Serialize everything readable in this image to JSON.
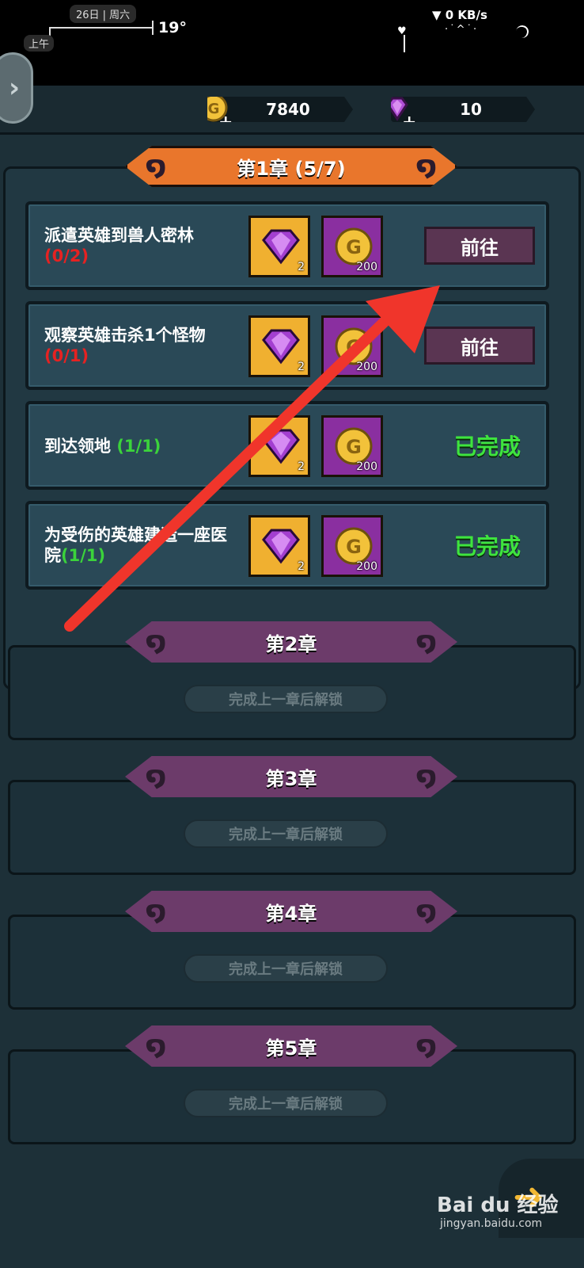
{
  "status_bar": {
    "date": "26日 | 周六",
    "ampm": "上午",
    "temperature": "19°",
    "network_speed": "▼ 0 KB/s"
  },
  "currency": {
    "gold": "7840",
    "gems": "10"
  },
  "chapter1": {
    "title": "第1章 (5/7)",
    "tasks": [
      {
        "name": "派遣英雄到兽人密林",
        "progress": "(0/2)",
        "reward_gem": "2",
        "reward_gold": "200",
        "action": "前往"
      },
      {
        "name": "观察英雄击杀1个怪物",
        "progress": "(0/1)",
        "reward_gem": "2",
        "reward_gold": "200",
        "action": "前往"
      },
      {
        "name": "到达领地",
        "progress": "(1/1)",
        "reward_gem": "2",
        "reward_gold": "200",
        "action": "已完成"
      },
      {
        "name": "为受伤的英雄建造一座医院",
        "progress": "(1/1)",
        "reward_gem": "2",
        "reward_gold": "200",
        "action": "已完成"
      }
    ]
  },
  "locked_chapters": [
    {
      "title": "第2章",
      "hint": "完成上一章后解锁"
    },
    {
      "title": "第3章",
      "hint": "完成上一章后解锁"
    },
    {
      "title": "第4章",
      "hint": "完成上一章后解锁"
    },
    {
      "title": "第5章",
      "hint": "完成上一章后解锁"
    }
  ],
  "watermark": {
    "brand": "Bai du 经验",
    "url": "jingyan.baidu.com"
  },
  "colors": {
    "accent_orange": "#e9762c",
    "locked_purple": "#6c3b6a",
    "annotation_arrow": "#f0352b",
    "progress_red": "#e52222",
    "progress_green": "#3bd33b"
  }
}
